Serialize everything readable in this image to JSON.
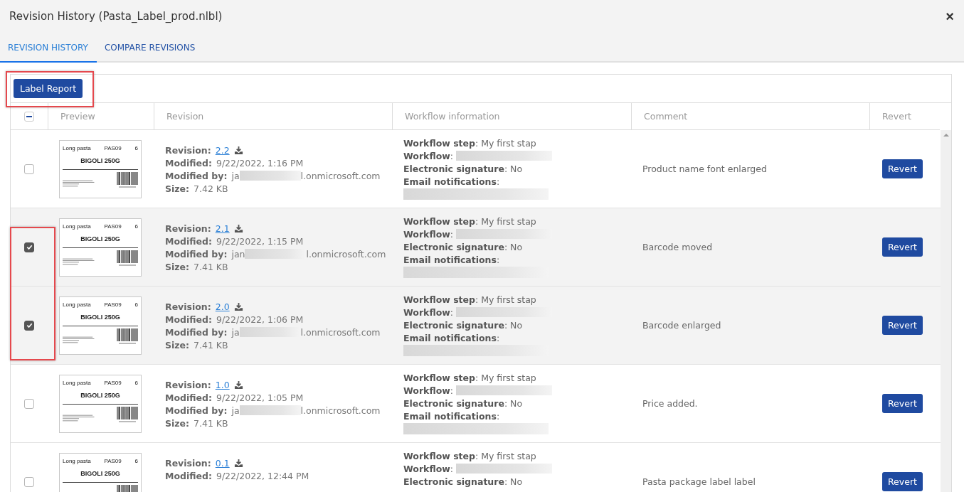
{
  "dialog": {
    "title": "Revision History (Pasta_Label_prod.nlbl)",
    "close": "×"
  },
  "tabs": [
    {
      "label": "REVISION HISTORY",
      "selected": true
    },
    {
      "label": "COMPARE REVISIONS",
      "selected": false
    }
  ],
  "toolbar": {
    "label_report": "Label Report",
    "annotated": true
  },
  "table": {
    "select_all_indeterminate": true,
    "columns": [
      "Preview",
      "Revision",
      "Workflow information",
      "Comment",
      "Revert"
    ],
    "rows": [
      {
        "selected": false,
        "annotated": false,
        "preview": {
          "category": "Long pasta",
          "product_id": "PAS09",
          "quantity": "6",
          "name": "BIGOLI 250G"
        },
        "details": [
          {
            "kind": "link",
            "label": "Revision:",
            "value": "2.2"
          },
          {
            "kind": "text",
            "label": "Modified:",
            "value": "9/22/2022, 1:16 PM"
          },
          {
            "kind": "redacted",
            "label": "Modified by:",
            "value": "ja",
            "suffix": "l.onmicrosoft.com"
          },
          {
            "kind": "text",
            "label": "Size:",
            "value": "7.42 KB"
          }
        ],
        "workflow": [
          {
            "kind": "text",
            "text": "**Workflow step**: My first stap"
          },
          {
            "kind": "redacted",
            "text": "**Workflow**:"
          },
          {
            "kind": "text",
            "text": "**Electronic signature**: No"
          },
          {
            "kind": "redacted-below",
            "text": "**Email notifications**:"
          }
        ],
        "comment": "Product name font enlarged",
        "revert": "Revert"
      },
      {
        "selected": true,
        "annotated": true,
        "preview": {
          "category": "Long pasta",
          "product_id": "PAS09",
          "quantity": "6",
          "name": "BIGOLI 250G"
        },
        "details": [
          {
            "kind": "link",
            "label": "Revision:",
            "value": "2.1"
          },
          {
            "kind": "text",
            "label": "Modified:",
            "value": "9/22/2022, 1:15 PM"
          },
          {
            "kind": "redacted",
            "label": "Modified by:",
            "value": "jan",
            "suffix": "l.onmicrosoft.com"
          },
          {
            "kind": "text",
            "label": "Size:",
            "value": "7.41 KB"
          }
        ],
        "workflow": [
          {
            "kind": "text",
            "text": "**Workflow step**: My first stap"
          },
          {
            "kind": "redacted",
            "text": "**Workflow**:"
          },
          {
            "kind": "text",
            "text": "**Electronic signature**: No"
          },
          {
            "kind": "redacted-below",
            "text": "**Email notifications**:"
          }
        ],
        "comment": "Barcode moved",
        "revert": "Revert"
      },
      {
        "selected": true,
        "annotated": true,
        "preview": {
          "category": "Long pasta",
          "product_id": "PAS09",
          "quantity": "6",
          "name": "BIGOLI 250G"
        },
        "details": [
          {
            "kind": "link",
            "label": "Revision:",
            "value": "2.0"
          },
          {
            "kind": "text",
            "label": "Modified:",
            "value": "9/22/2022, 1:06 PM"
          },
          {
            "kind": "redacted",
            "label": "Modified by:",
            "value": "ja",
            "suffix": "l.onmicrosoft.com"
          },
          {
            "kind": "text",
            "label": "Size:",
            "value": "7.41 KB"
          }
        ],
        "workflow": [
          {
            "kind": "text",
            "text": "**Workflow step**: My first stap"
          },
          {
            "kind": "redacted",
            "text": "**Workflow**:"
          },
          {
            "kind": "text",
            "text": "**Electronic signature**: No"
          },
          {
            "kind": "redacted-below",
            "text": "**Email notifications**:"
          }
        ],
        "comment": "Barcode enlarged",
        "revert": "Revert"
      },
      {
        "selected": false,
        "annotated": false,
        "preview": {
          "category": "Long pasta",
          "product_id": "PAS09",
          "quantity": "6",
          "name": "BIGOLI 250G"
        },
        "details": [
          {
            "kind": "link",
            "label": "Revision:",
            "value": "1.0"
          },
          {
            "kind": "text",
            "label": "Modified:",
            "value": "9/22/2022, 1:05 PM"
          },
          {
            "kind": "redacted",
            "label": "Modified by:",
            "value": "ja",
            "suffix": "l.onmicrosoft.com"
          },
          {
            "kind": "text",
            "label": "Size:",
            "value": "7.41 KB"
          }
        ],
        "workflow": [
          {
            "kind": "text",
            "text": "**Workflow step**: My first stap"
          },
          {
            "kind": "redacted",
            "text": "**Workflow**:"
          },
          {
            "kind": "text",
            "text": "**Electronic signature**: No"
          },
          {
            "kind": "redacted-below",
            "text": "**Email notifications**:"
          }
        ],
        "comment": "Price added.",
        "revert": "Revert"
      },
      {
        "selected": false,
        "annotated": false,
        "preview": {
          "category": "Long pasta",
          "product_id": "PAS09",
          "quantity": "6",
          "name": "BIGOLI 250G"
        },
        "details": [
          {
            "kind": "link",
            "label": "Revision:",
            "value": "0.1"
          },
          {
            "kind": "text",
            "label": "Modified:",
            "value": "9/22/2022, 12:44 PM"
          }
        ],
        "workflow": [
          {
            "kind": "text",
            "text": "**Workflow step**: My first stap"
          },
          {
            "kind": "redacted",
            "text": "**Workflow**:"
          },
          {
            "kind": "text",
            "text": "**Electronic signature**: No"
          }
        ],
        "comment": "Pasta package label label",
        "revert": "Revert"
      }
    ]
  }
}
